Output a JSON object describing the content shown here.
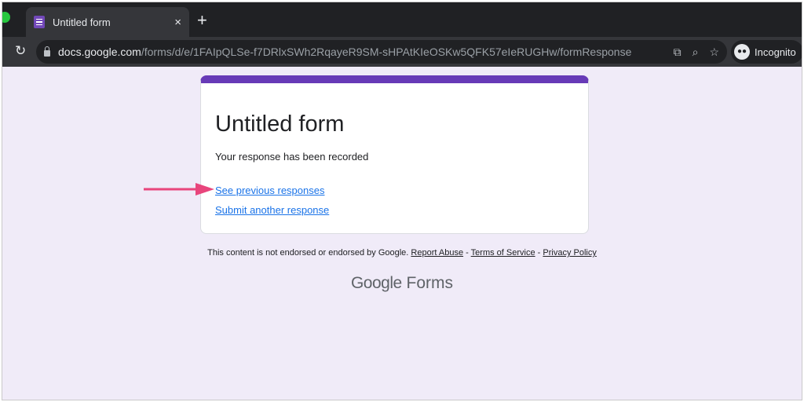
{
  "browser": {
    "tab": {
      "title": "Untitled form",
      "close": "×"
    },
    "new_tab": "+",
    "url": {
      "host": "docs.google.com",
      "path": "/forms/d/e/1FAIpQLSe-f7DRlxSWh2RqayeR9SM-sHPAtKIeOSKw5QFK57eIeRUGHw/formResponse"
    },
    "profile": "Incognito",
    "icons": [
      "reload-icon",
      "lock-icon",
      "translate-icon",
      "zoom-icon",
      "star-icon",
      "incognito-icon"
    ]
  },
  "form": {
    "title": "Untitled form",
    "message": "Your response has been recorded",
    "links": [
      "See previous responses",
      "Submit another response"
    ],
    "accent": "#673ab7"
  },
  "annotation": {
    "arrow_color": "#e8457c"
  },
  "footer": {
    "disclaimer": "This content is not endorsed or endorsed by Google.",
    "report": "Report Abuse",
    "terms": "Terms of Service",
    "privacy": "Privacy Policy",
    "sep": "-",
    "brand_google": "Google",
    "brand_forms": "Forms"
  }
}
